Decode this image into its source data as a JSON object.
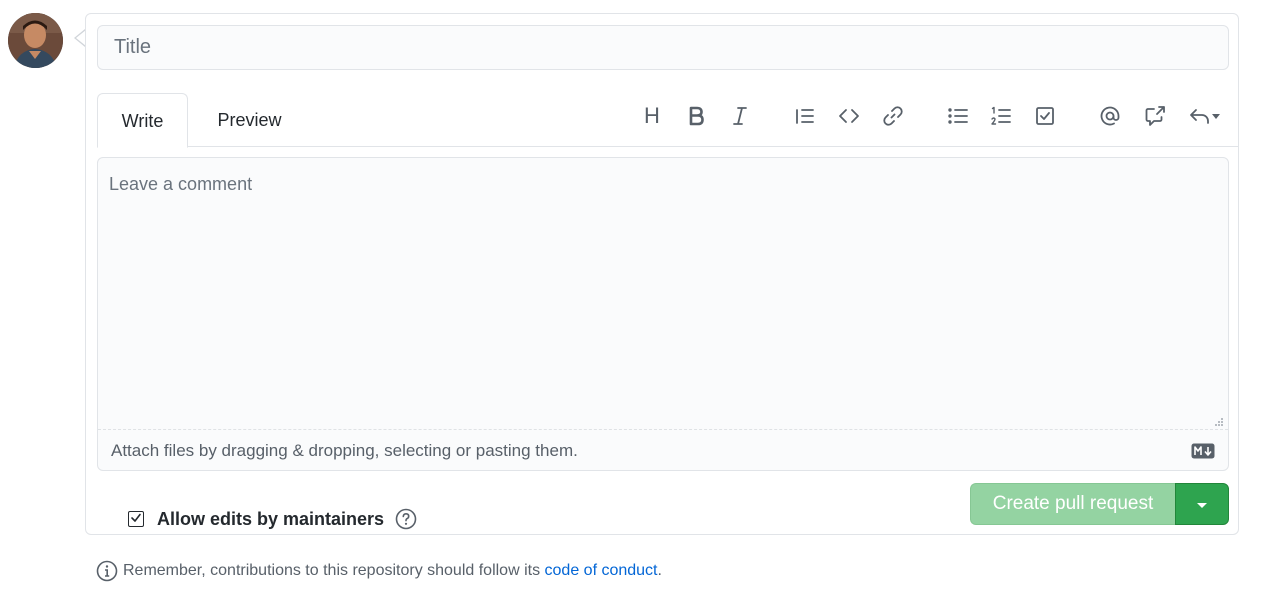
{
  "form": {
    "title_placeholder": "Title",
    "tabs": [
      {
        "label": "Write"
      },
      {
        "label": "Preview"
      }
    ],
    "toolbar": {
      "heading_label": "H",
      "icons": [
        "heading-icon",
        "bold-icon",
        "italic-icon",
        "quote-icon",
        "code-icon",
        "link-icon",
        "bullet-list-icon",
        "numbered-list-icon",
        "task-list-icon",
        "mention-icon",
        "cross-reference-icon",
        "reply-icon"
      ]
    },
    "comment_placeholder": "Leave a comment",
    "attach_text": "Attach files by dragging & dropping, selecting or pasting them.",
    "markdown_badge": "M↓",
    "allow_edits_label": "Allow edits by maintainers",
    "allow_edits_checked": true,
    "create_button_label": "Create pull request"
  },
  "notice": {
    "prefix": "Remember, contributions to this repository should follow its",
    "link_text": "code of conduct",
    "suffix": "."
  },
  "colors": {
    "primary_green": "#2ea44f",
    "disabled_green": "#94d3a2",
    "link_blue": "#0366d6"
  }
}
